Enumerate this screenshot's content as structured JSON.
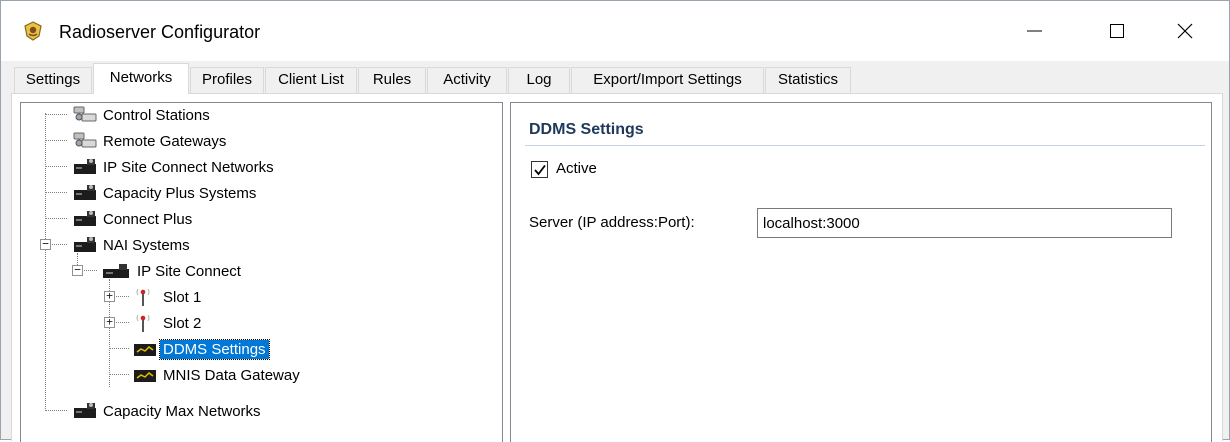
{
  "window": {
    "title": "Radioserver Configurator",
    "app_icon": "radioserver-app-icon"
  },
  "tabs": [
    {
      "label": "Settings"
    },
    {
      "label": "Networks",
      "active": true
    },
    {
      "label": "Profiles"
    },
    {
      "label": "Client List"
    },
    {
      "label": "Rules"
    },
    {
      "label": "Activity"
    },
    {
      "label": "Log"
    },
    {
      "label": "Export/Import Settings"
    },
    {
      "label": "Statistics"
    }
  ],
  "tree": {
    "items": [
      {
        "label": "Control Stations",
        "icon": "control-station-icon"
      },
      {
        "label": "Remote Gateways",
        "icon": "gateway-icon"
      },
      {
        "label": "IP Site Connect Networks",
        "icon": "network-icon"
      },
      {
        "label": "Capacity Plus Systems",
        "icon": "network-icon"
      },
      {
        "label": "Connect Plus",
        "icon": "network-icon"
      },
      {
        "label": "NAI Systems",
        "icon": "network-icon",
        "expanded": true
      },
      {
        "label": "IP Site Connect",
        "icon": "network-icon",
        "expanded": true
      },
      {
        "label": "Slot 1",
        "icon": "antenna-icon",
        "collapsed": true
      },
      {
        "label": "Slot 2",
        "icon": "antenna-icon",
        "collapsed": true
      },
      {
        "label": "DDMS Settings",
        "icon": "server-icon",
        "selected": true
      },
      {
        "label": "MNIS Data Gateway",
        "icon": "server-icon"
      },
      {
        "label": "Capacity Max Networks",
        "icon": "network-icon"
      }
    ]
  },
  "panel": {
    "title": "DDMS Settings",
    "active_label": "Active",
    "active_checked": true,
    "server_label": "Server (IP address:Port):",
    "server_value": "localhost:3000"
  },
  "colors": {
    "selection": "#0078d7",
    "panel_title": "#1e395b"
  }
}
